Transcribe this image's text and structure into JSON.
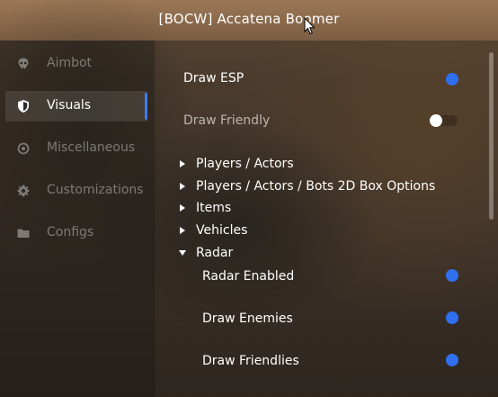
{
  "window": {
    "title": "[BOCW] Accatena Boomer"
  },
  "sidebar": {
    "items": [
      {
        "label": "Aimbot",
        "icon": "skull-icon",
        "active": false
      },
      {
        "label": "Visuals",
        "icon": "shield-icon",
        "active": true
      },
      {
        "label": "Miscellaneous",
        "icon": "target-icon",
        "active": false
      },
      {
        "label": "Customizations",
        "icon": "gear-icon",
        "active": false
      },
      {
        "label": "Configs",
        "icon": "folder-icon",
        "active": false
      }
    ]
  },
  "main": {
    "draw_esp": {
      "label": "Draw ESP",
      "enabled": true
    },
    "draw_friendly": {
      "label": "Draw Friendly",
      "enabled": false
    },
    "tree": [
      {
        "label": "Players / Actors",
        "expanded": false
      },
      {
        "label": "Players / Actors / Bots 2D Box Options",
        "expanded": false
      },
      {
        "label": "Items",
        "expanded": false
      },
      {
        "label": "Vehicles",
        "expanded": false
      },
      {
        "label": "Radar",
        "expanded": true
      }
    ],
    "radar": {
      "radar_enabled": {
        "label": "Radar Enabled",
        "enabled": true
      },
      "draw_enemies": {
        "label": "Draw Enemies",
        "enabled": true
      },
      "draw_friendlies": {
        "label": "Draw Friendlies",
        "enabled": true
      }
    }
  },
  "colors": {
    "accent": "#2f6ff0",
    "text": "#ffffff"
  }
}
